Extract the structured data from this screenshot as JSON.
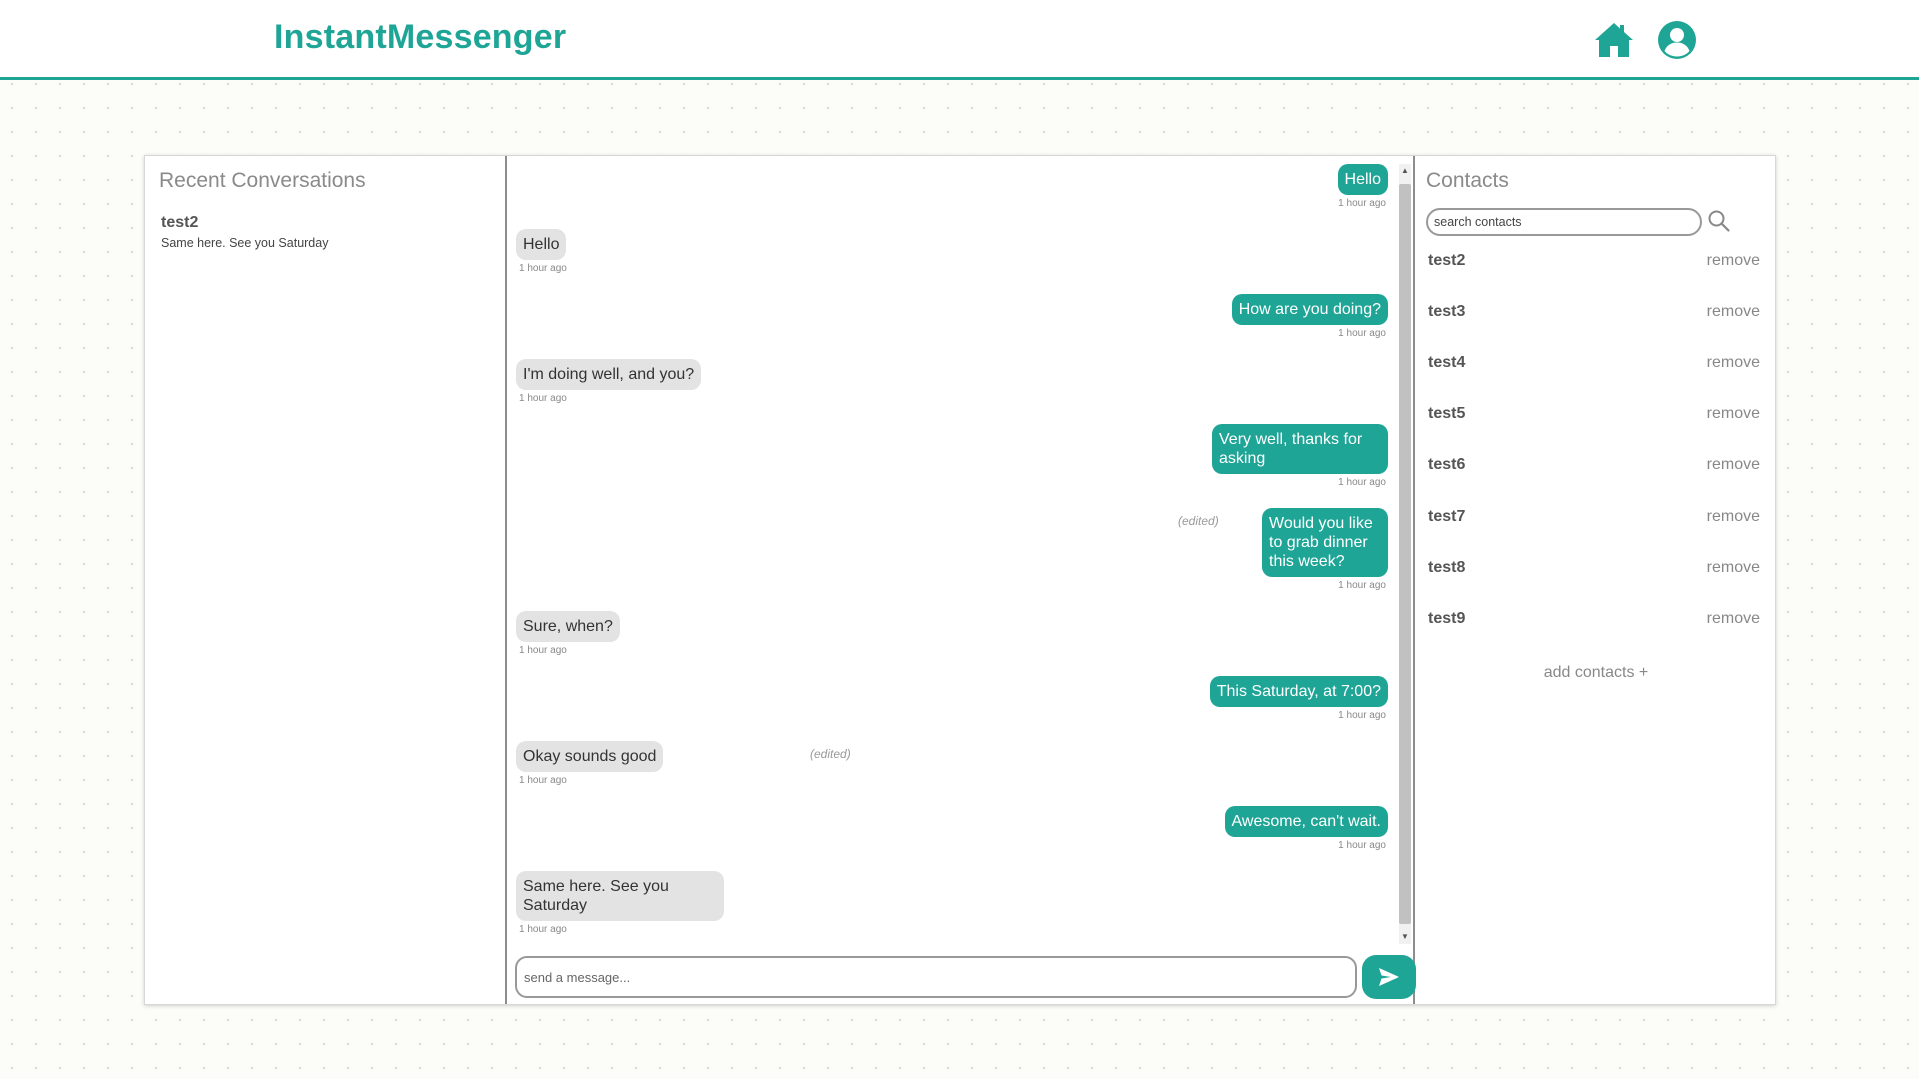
{
  "app": {
    "title": "InstantMessenger"
  },
  "icons": {
    "home": "home-icon",
    "account": "user-circle-icon",
    "search": "search-icon",
    "send": "send-icon"
  },
  "colors": {
    "accent": "#1fa596",
    "incoming_bubble": "#e3e3e3"
  },
  "recent": {
    "title": "Recent Conversations",
    "items": [
      {
        "name": "test2",
        "preview": "Same here. See you Saturday"
      }
    ]
  },
  "chat": {
    "messages": [
      {
        "dir": "out",
        "text": "Hello",
        "time": "1 hour ago"
      },
      {
        "dir": "in",
        "text": "Hello",
        "time": "1 hour ago"
      },
      {
        "dir": "out",
        "text": "How are you doing?",
        "time": "1 hour ago"
      },
      {
        "dir": "in",
        "text": "I'm doing well, and you?",
        "time": "1 hour ago"
      },
      {
        "dir": "out",
        "text": "Very well, thanks for asking",
        "time": "1 hour ago"
      },
      {
        "dir": "out",
        "text": "Would you like to grab dinner this week?",
        "time": "1 hour ago",
        "edited": "(edited)"
      },
      {
        "dir": "in",
        "text": "Sure, when?",
        "time": "1 hour ago"
      },
      {
        "dir": "out",
        "text": "This Saturday, at 7:00?",
        "time": "1 hour ago"
      },
      {
        "dir": "in",
        "text": "Okay sounds good",
        "time": "1 hour ago",
        "edited": "(edited)"
      },
      {
        "dir": "out",
        "text": "Awesome, can't wait.",
        "time": "1 hour ago"
      },
      {
        "dir": "in",
        "text": "Same here. See you Saturday",
        "time": "1 hour ago"
      }
    ],
    "composer": {
      "placeholder": "send a message...",
      "value": ""
    }
  },
  "contacts": {
    "title": "Contacts",
    "search_placeholder": "search contacts",
    "remove_label": "remove",
    "items": [
      {
        "name": "test2"
      },
      {
        "name": "test3"
      },
      {
        "name": "test4"
      },
      {
        "name": "test5"
      },
      {
        "name": "test6"
      },
      {
        "name": "test7"
      },
      {
        "name": "test8"
      },
      {
        "name": "test9"
      }
    ],
    "add_label": "add contacts +"
  }
}
